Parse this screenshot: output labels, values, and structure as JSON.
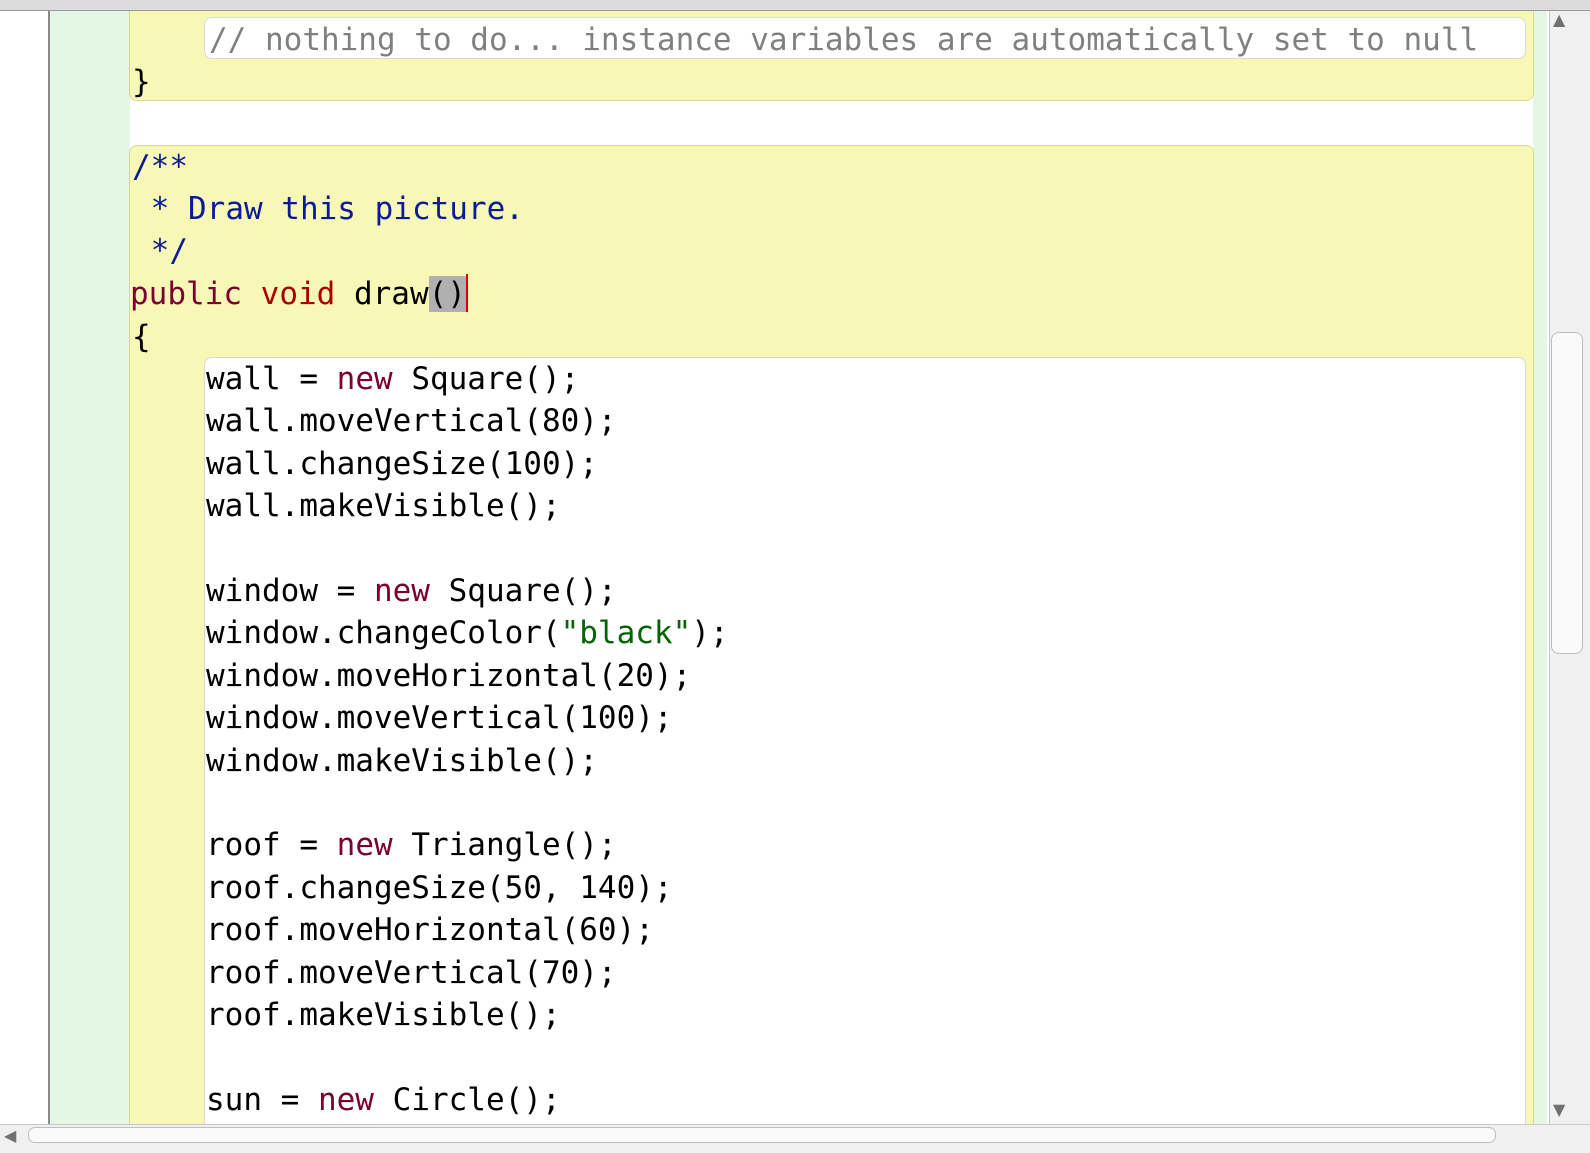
{
  "editor": {
    "top_lines": [
      {
        "text": "// nothing to do... instance variables are automatically set to null"
      },
      {
        "text": "}"
      }
    ],
    "javadoc": {
      "open": "/**",
      "body": " * Draw this picture.",
      "close": " */"
    },
    "signature": {
      "kw_public": "public",
      "kw_void": "void",
      "name": "draw",
      "parens": "()"
    },
    "open_brace": "{",
    "body_lines": [
      [
        "wall = ",
        "new",
        " Square();"
      ],
      [
        "wall.moveVertical(80);"
      ],
      [
        "wall.changeSize(100);"
      ],
      [
        "wall.makeVisible();"
      ],
      [
        ""
      ],
      [
        "window = ",
        "new",
        " Square();"
      ],
      [
        "window.changeColor(",
        "\"black\"",
        ");"
      ],
      [
        "window.moveHorizontal(20);"
      ],
      [
        "window.moveVertical(100);"
      ],
      [
        "window.makeVisible();"
      ],
      [
        ""
      ],
      [
        "roof = ",
        "new",
        " Triangle();"
      ],
      [
        "roof.changeSize(50, 140);"
      ],
      [
        "roof.moveHorizontal(60);"
      ],
      [
        "roof.moveVertical(70);"
      ],
      [
        "roof.makeVisible();"
      ],
      [
        ""
      ],
      [
        "sun = ",
        "new",
        " Circle();"
      ]
    ]
  },
  "colors": {
    "keyword": "#7a0033",
    "keyword_void": "#aa0000",
    "string": "#006400",
    "comment": "#0a1a9a",
    "scope_yellow": "#f8f8b6",
    "scope_green": "#e4f7e4"
  },
  "icons": {
    "scroll_up": "triangle-up-icon",
    "scroll_down": "triangle-down-icon",
    "scroll_left": "triangle-left-icon"
  }
}
